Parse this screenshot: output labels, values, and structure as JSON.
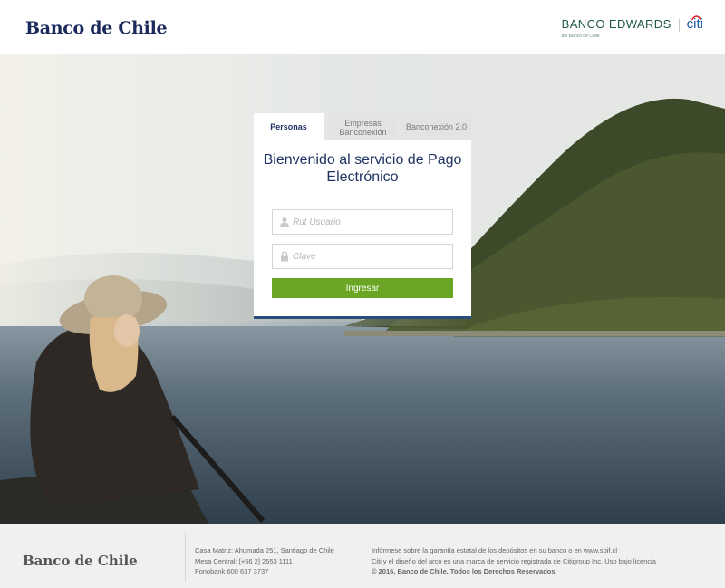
{
  "header": {
    "left_logo": "Banco de Chile",
    "right_brand": "BANCO EDWARDS",
    "right_brand_sub": "del Banco de Chile",
    "citi_logo": "citi"
  },
  "login": {
    "tabs": [
      {
        "label": "Personas",
        "active": true
      },
      {
        "label": "Empresas Banconexión",
        "active": false
      },
      {
        "label": "Banconexión 2.0",
        "active": false
      }
    ],
    "title": "Bienvenido al servicio de Pago Electrónico",
    "user_placeholder": "Rut Usuario",
    "password_placeholder": "Clave",
    "submit_label": "Ingresar",
    "icons": {
      "user": "user-icon",
      "password": "lock-icon"
    }
  },
  "footer": {
    "logo": "Banco de Chile",
    "address": "Casa Matriz: Ahumada 251, Santiago de Chile",
    "phone": "Mesa Central: [+56 2] 2653 1111",
    "fonobank": "Fonobank 600 637 3737",
    "guarantee": "Infórmese sobre la garantía estatal de los depósitos en su banco o en www.sbif.cl",
    "citi_notice": "Citi y el diseño del arco es una marca de servicio registrada de Citigroup Inc. Uso bajo licencia",
    "copyright": "© 2016, Banco de Chile. Todos los Derechos Reservados"
  },
  "colors": {
    "brand_navy": "#1f3463",
    "button_green": "#6aa624",
    "edwards_green": "#1d5c3c",
    "citi_blue": "#1e5aa6"
  }
}
